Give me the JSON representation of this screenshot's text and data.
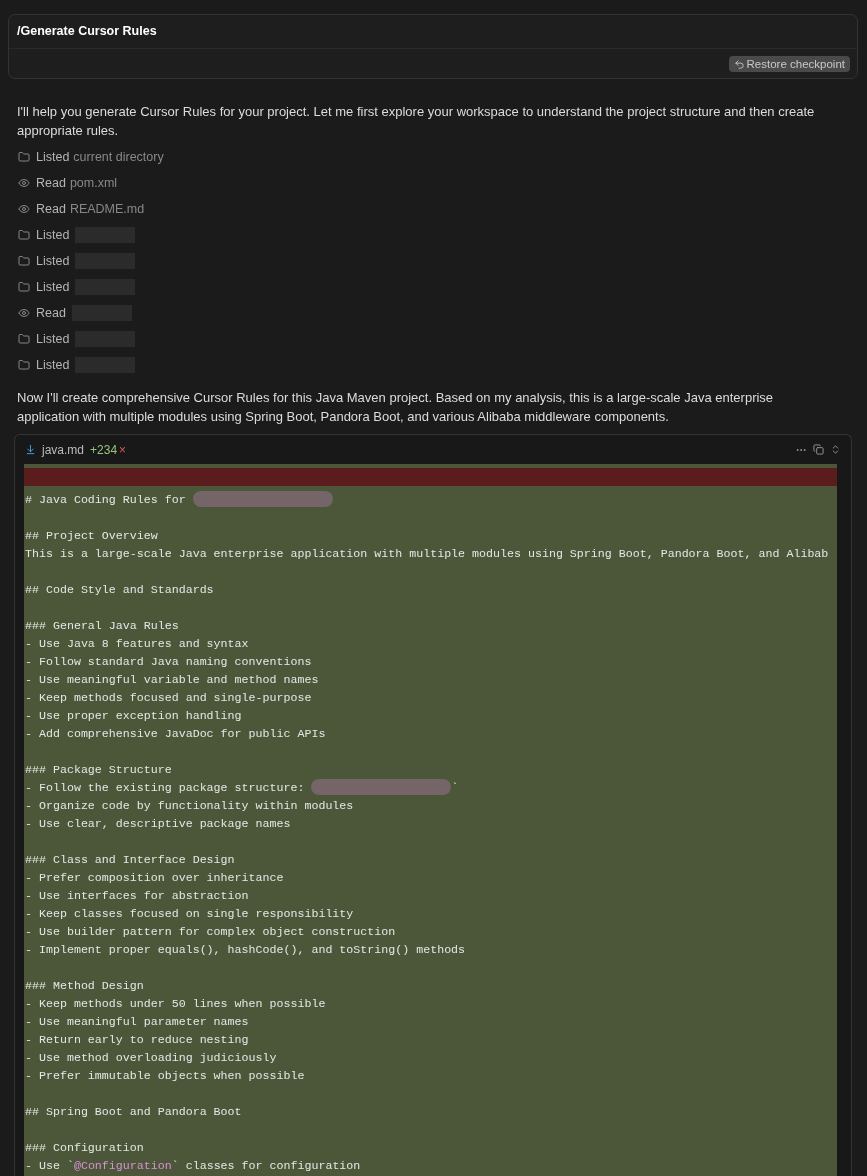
{
  "prompt": {
    "text": "/Generate Cursor Rules",
    "button": "Restore checkpoint"
  },
  "intro": "I'll help you generate Cursor Rules for your project. Let me first explore your workspace to understand the project structure and then create appropriate rules.",
  "steps": [
    {
      "kind": "list",
      "action": "Listed",
      "target": "current directory"
    },
    {
      "kind": "read",
      "action": "Read",
      "target": "pom.xml"
    },
    {
      "kind": "read",
      "action": "Read",
      "target": "README.md"
    },
    {
      "kind": "list",
      "action": "Listed",
      "redacted": true
    },
    {
      "kind": "list",
      "action": "Listed",
      "redacted": true
    },
    {
      "kind": "list",
      "action": "Listed",
      "redacted": true
    },
    {
      "kind": "read",
      "action": "Read",
      "redacted": true
    },
    {
      "kind": "list",
      "action": "Listed",
      "redacted": true
    },
    {
      "kind": "list",
      "action": "Listed",
      "redacted": true
    }
  ],
  "summary": "Now I'll create comprehensive Cursor Rules for this Java Maven project. Based on my analysis, this is a large-scale Java enterprise application with multiple modules using Spring Boot, Pandora Boot, and various Alibaba middleware components.",
  "file": {
    "name": "java.md",
    "added": "+234",
    "reject": "×",
    "lines": [
      {
        "kind": "mixed",
        "segments": [
          {
            "kind": "plain",
            "text": "# Java Coding Rules for "
          },
          {
            "kind": "redacted"
          }
        ]
      },
      {
        "kind": "blank"
      },
      {
        "kind": "text",
        "text": "## Project Overview"
      },
      {
        "kind": "text",
        "text": "This is a large-scale Java enterprise application with multiple modules using Spring Boot, Pandora Boot, and Alibab"
      },
      {
        "kind": "blank"
      },
      {
        "kind": "text",
        "text": "## Code Style and Standards"
      },
      {
        "kind": "blank"
      },
      {
        "kind": "text",
        "text": "### General Java Rules"
      },
      {
        "kind": "text",
        "text": "- Use Java 8 features and syntax"
      },
      {
        "kind": "text",
        "text": "- Follow standard Java naming conventions"
      },
      {
        "kind": "text",
        "text": "- Use meaningful variable and method names"
      },
      {
        "kind": "text",
        "text": "- Keep methods focused and single-purpose"
      },
      {
        "kind": "text",
        "text": "- Use proper exception handling"
      },
      {
        "kind": "text",
        "text": "- Add comprehensive JavaDoc for public APIs"
      },
      {
        "kind": "blank"
      },
      {
        "kind": "text",
        "text": "### Package Structure"
      },
      {
        "kind": "mixed",
        "segments": [
          {
            "kind": "plain",
            "text": "- Follow the existing package structure: "
          },
          {
            "kind": "redacted"
          },
          {
            "kind": "plain",
            "text": "`"
          }
        ]
      },
      {
        "kind": "text",
        "text": "- Organize code by functionality within modules"
      },
      {
        "kind": "text",
        "text": "- Use clear, descriptive package names"
      },
      {
        "kind": "blank"
      },
      {
        "kind": "text",
        "text": "### Class and Interface Design"
      },
      {
        "kind": "text",
        "text": "- Prefer composition over inheritance"
      },
      {
        "kind": "text",
        "text": "- Use interfaces for abstraction"
      },
      {
        "kind": "text",
        "text": "- Keep classes focused on single responsibility"
      },
      {
        "kind": "text",
        "text": "- Use builder pattern for complex object construction"
      },
      {
        "kind": "text",
        "text": "- Implement proper equals(), hashCode(), and toString() methods"
      },
      {
        "kind": "blank"
      },
      {
        "kind": "text",
        "text": "### Method Design"
      },
      {
        "kind": "text",
        "text": "- Keep methods under 50 lines when possible"
      },
      {
        "kind": "text",
        "text": "- Use meaningful parameter names"
      },
      {
        "kind": "text",
        "text": "- Return early to reduce nesting"
      },
      {
        "kind": "text",
        "text": "- Use method overloading judiciously"
      },
      {
        "kind": "text",
        "text": "- Prefer immutable objects when possible"
      },
      {
        "kind": "blank"
      },
      {
        "kind": "text",
        "text": "## Spring Boot and Pandora Boot"
      },
      {
        "kind": "blank"
      },
      {
        "kind": "text",
        "text": "### Configuration"
      },
      {
        "kind": "mixed",
        "segments": [
          {
            "kind": "plain",
            "text": "- Use `"
          },
          {
            "kind": "code",
            "text": "@Configuration"
          },
          {
            "kind": "plain",
            "text": "` classes for configuration"
          }
        ]
      }
    ]
  }
}
